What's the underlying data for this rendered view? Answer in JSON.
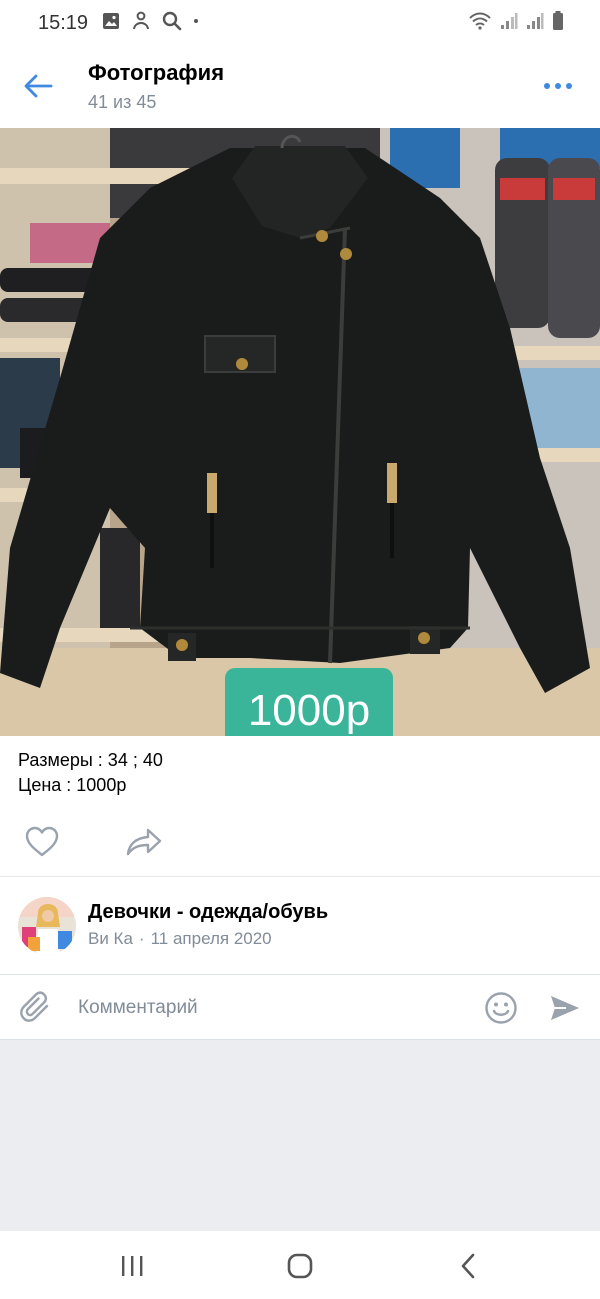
{
  "status_bar": {
    "time": "15:19",
    "left_icons": [
      "gallery-icon",
      "bixby-icon",
      "search-icon"
    ],
    "right_icons": [
      "wifi-icon",
      "signal-icon",
      "signal-icon",
      "battery-icon"
    ]
  },
  "header": {
    "title": "Фотография",
    "subtitle": "41 из 45",
    "accent_color": "#3f8ae0"
  },
  "photo": {
    "price_tag": "1000р",
    "price_tag_color": "#3ab59a"
  },
  "description": {
    "sizes": "Размеры : 34 ; 40",
    "price": "Цена : 1000р"
  },
  "post": {
    "group_name": "Девочки - одежда/обувь",
    "author": "Ви Ка",
    "separator": "·",
    "date": "11 апреля 2020"
  },
  "comment": {
    "placeholder": "Комментарий"
  },
  "nav": {
    "icons": [
      "recent-apps-icon",
      "home-icon",
      "back-icon"
    ]
  }
}
